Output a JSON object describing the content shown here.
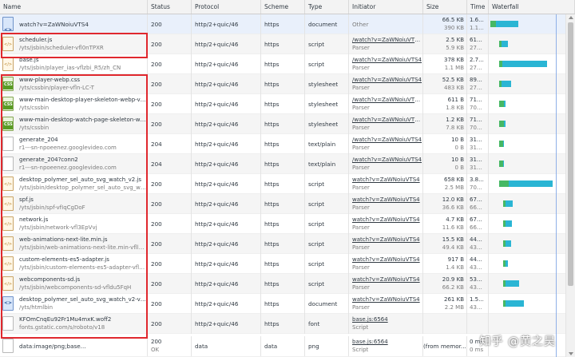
{
  "columns": [
    "Name",
    "Status",
    "Protocol",
    "Scheme",
    "Type",
    "Initiator",
    "Size",
    "Time",
    "Waterfall"
  ],
  "rows": [
    {
      "name": "watch?v=ZaWNoiuVTS4",
      "path": "",
      "status": "200",
      "status_sub": "",
      "protocol": "http/2+quic/46",
      "scheme": "https",
      "type": "document",
      "initiator": "Other",
      "initiator_sub": "",
      "init_link": false,
      "size": "66.5 KB",
      "size_sub": "390 KB",
      "time": "1.6...",
      "time_sub": "1.1...",
      "icon": "doc-icon",
      "wait": [
        2,
        9
      ],
      "bar": [
        9,
        28
      ]
    },
    {
      "name": "scheduler.js",
      "path": "/yts/jsbin/scheduler-vfl0nTPXR",
      "status": "200",
      "status_sub": "",
      "protocol": "http/2+quic/46",
      "scheme": "https",
      "type": "script",
      "initiator": "/watch?v=ZaWNoiuVTS4:2",
      "initiator_sub": "Parser",
      "init_link": true,
      "size": "2.5 KB",
      "size_sub": "5.9 KB",
      "time": "610...",
      "time_sub": "275...",
      "icon": "js-icon",
      "wait": [
        13,
        3
      ],
      "bar": [
        16,
        8
      ]
    },
    {
      "name": "base.js",
      "path": "/yts/jsbin/player_ias-vflzbi_R5/zh_CN",
      "status": "200",
      "status_sub": "",
      "protocol": "http/2+quic/46",
      "scheme": "https",
      "type": "script",
      "initiator": "/watch?v=ZaWNoiuVTS4",
      "initiator_sub": "Parser",
      "init_link": true,
      "size": "378 KB",
      "size_sub": "1.1 MB",
      "time": "2.7...",
      "time_sub": "275...",
      "icon": "js-icon",
      "wait": [
        13,
        4
      ],
      "bar": [
        17,
        56
      ]
    },
    {
      "name": "www-player-webp.css",
      "path": "/yts/cssbin/player-vfln-LC-T",
      "status": "200",
      "status_sub": "",
      "protocol": "http/2+quic/46",
      "scheme": "https",
      "type": "stylesheet",
      "initiator": "/watch?v=ZaWNoiuVTS4",
      "initiator_sub": "Parser",
      "init_link": true,
      "size": "52.5 KB",
      "size_sub": "483 KB",
      "time": "898...",
      "time_sub": "275...",
      "icon": "css-icon",
      "wait": [
        13,
        3
      ],
      "bar": [
        16,
        12
      ]
    },
    {
      "name": "www-main-desktop-player-skeleton-webp-vflV...",
      "path": "/yts/cssbin",
      "status": "200",
      "status_sub": "",
      "protocol": "http/2+quic/46",
      "scheme": "https",
      "type": "stylesheet",
      "initiator": "/watch?v=ZaWNoiuVTS4:7",
      "initiator_sub": "Parser",
      "init_link": true,
      "size": "611 B",
      "size_sub": "1.8 KB",
      "time": "711...",
      "time_sub": "709...",
      "icon": "css-icon",
      "wait": [
        13,
        6
      ],
      "bar": [
        19,
        2
      ]
    },
    {
      "name": "www-main-desktop-watch-page-skeleton-web...",
      "path": "/yts/cssbin",
      "status": "200",
      "status_sub": "",
      "protocol": "http/2+quic/46",
      "scheme": "https",
      "type": "stylesheet",
      "initiator": "/watch?v=ZaWNoiuVTS4:7",
      "initiator_sub": "Parser",
      "init_link": true,
      "size": "1.2 KB",
      "size_sub": "7.8 KB",
      "time": "711...",
      "time_sub": "709...",
      "icon": "css-icon",
      "wait": [
        13,
        6
      ],
      "bar": [
        19,
        2
      ]
    },
    {
      "name": "generate_204",
      "path": "r1---sn-npoeenez.googlevideo.com",
      "status": "204",
      "status_sub": "",
      "protocol": "http/2+quic/46",
      "scheme": "https",
      "type": "text/plain",
      "initiator": "/watch?v=ZaWNoiuVTS4",
      "initiator_sub": "Parser",
      "init_link": true,
      "size": "10 B",
      "size_sub": "0 B",
      "time": "312...",
      "time_sub": "311...",
      "icon": "file-icon",
      "wait": [
        13,
        5
      ],
      "bar": [
        18,
        1
      ]
    },
    {
      "name": "generate_204?conn2",
      "path": "r1---sn-npoeenez.googlevideo.com",
      "status": "204",
      "status_sub": "",
      "protocol": "http/2+quic/46",
      "scheme": "https",
      "type": "text/plain",
      "initiator": "/watch?v=ZaWNoiuVTS4",
      "initiator_sub": "Parser",
      "init_link": true,
      "size": "10 B",
      "size_sub": "0 B",
      "time": "312...",
      "time_sub": "311...",
      "icon": "file-icon",
      "wait": [
        13,
        5
      ],
      "bar": [
        18,
        1
      ]
    },
    {
      "name": "desktop_polymer_sel_auto_svg_watch_v2.js",
      "path": "/yts/jsbin/desktop_polymer_sel_auto_svg_watch...",
      "status": "200",
      "status_sub": "",
      "protocol": "http/2+quic/46",
      "scheme": "https",
      "type": "script",
      "initiator": "watch?v=ZaWNoiuVTS4",
      "initiator_sub": "Parser",
      "init_link": true,
      "size": "658 KB",
      "size_sub": "2.5 MB",
      "time": "3.8...",
      "time_sub": "708...",
      "icon": "js-icon",
      "wait": [
        13,
        12
      ],
      "bar": [
        25,
        55
      ]
    },
    {
      "name": "spf.js",
      "path": "/yts/jsbin/spf-vfIqCgDoF",
      "status": "200",
      "status_sub": "",
      "protocol": "http/2+quic/46",
      "scheme": "https",
      "type": "script",
      "initiator": "watch?v=ZaWNoiuVTS4",
      "initiator_sub": "Parser",
      "init_link": true,
      "size": "12.0 KB",
      "size_sub": "36.6 KB",
      "time": "672...",
      "time_sub": "669...",
      "icon": "js-icon",
      "wait": [
        18,
        3
      ],
      "bar": [
        21,
        9
      ]
    },
    {
      "name": "network.js",
      "path": "/yts/jsbin/network-vfl3EpVvj",
      "status": "200",
      "status_sub": "",
      "protocol": "http/2+quic/46",
      "scheme": "https",
      "type": "script",
      "initiator": "watch?v=ZaWNoiuVTS4",
      "initiator_sub": "Parser",
      "init_link": true,
      "size": "4.7 KB",
      "size_sub": "11.6 KB",
      "time": "672...",
      "time_sub": "669...",
      "icon": "js-icon",
      "wait": [
        18,
        3
      ],
      "bar": [
        21,
        8
      ]
    },
    {
      "name": "web-animations-next-lite.min.js",
      "path": "/yts/jsbin/web-animations-next-lite.min-vflluX...",
      "status": "200",
      "status_sub": "",
      "protocol": "http/2+quic/46",
      "scheme": "https",
      "type": "script",
      "initiator": "watch?v=ZaWNoiuVTS4",
      "initiator_sub": "Parser",
      "init_link": true,
      "size": "15.5 KB",
      "size_sub": "49.4 KB",
      "time": "441...",
      "time_sub": "439...",
      "icon": "js-icon",
      "wait": [
        18,
        3
      ],
      "bar": [
        21,
        7
      ]
    },
    {
      "name": "custom-elements-es5-adapter.js",
      "path": "/yts/jsbin/custom-elements-es5-adapter-vflsrw...",
      "status": "200",
      "status_sub": "",
      "protocol": "http/2+quic/46",
      "scheme": "https",
      "type": "script",
      "initiator": "watch?v=ZaWNoiuVTS4",
      "initiator_sub": "Parser",
      "init_link": true,
      "size": "917 B",
      "size_sub": "1.4 KB",
      "time": "441...",
      "time_sub": "439...",
      "icon": "js-icon",
      "wait": [
        18,
        3
      ],
      "bar": [
        21,
        3
      ]
    },
    {
      "name": "webcomponents-sd.js",
      "path": "/yts/jsbin/webcomponents-sd-vfldu5FqH",
      "status": "200",
      "status_sub": "",
      "protocol": "http/2+quic/46",
      "scheme": "https",
      "type": "script",
      "initiator": "watch?v=ZaWNoiuVTS4",
      "initiator_sub": "Parser",
      "init_link": true,
      "size": "20.9 KB",
      "size_sub": "66.2 KB",
      "time": "539...",
      "time_sub": "439...",
      "icon": "js-icon",
      "wait": [
        18,
        3
      ],
      "bar": [
        21,
        17
      ]
    },
    {
      "name": "desktop_polymer_sel_auto_svg_watch_v2-vfl_E...",
      "path": "/yts/htmlbin",
      "status": "200",
      "status_sub": "",
      "protocol": "http/2+quic/46",
      "scheme": "https",
      "type": "document",
      "initiator": "watch?v=ZaWNoiuVTS4",
      "initiator_sub": "Parser",
      "init_link": true,
      "size": "261 KB",
      "size_sub": "2.2 MB",
      "time": "1.5...",
      "time_sub": "439...",
      "icon": "doc-icon",
      "wait": [
        18,
        3
      ],
      "bar": [
        21,
        23
      ]
    },
    {
      "name": "KFOmCnqEu92Fr1Mu4mxK.woff2",
      "path": "fonts.gstatic.com/s/roboto/v18",
      "status": "200",
      "status_sub": "",
      "protocol": "http/2+quic/46",
      "scheme": "https",
      "type": "font",
      "initiator": "base.js:6564",
      "initiator_sub": "Script",
      "init_link": true,
      "size": "",
      "size_sub": "",
      "time": "",
      "time_sub": "",
      "icon": "font-icon",
      "wait": [
        0,
        0
      ],
      "bar": [
        0,
        0
      ]
    },
    {
      "name": "data:image/png;base...",
      "path": "",
      "status": "200",
      "status_sub": "OK",
      "protocol": "data",
      "scheme": "data",
      "type": "png",
      "initiator": "base.js:6564",
      "initiator_sub": "Script",
      "init_link": true,
      "size": "(from memor...",
      "size_sub": "",
      "time": "0 ms",
      "time_sub": "0 ms",
      "icon": "file-icon",
      "wait": [
        0,
        0
      ],
      "bar": [
        0,
        0
      ]
    }
  ],
  "watermark": "知乎 @黄之昊"
}
